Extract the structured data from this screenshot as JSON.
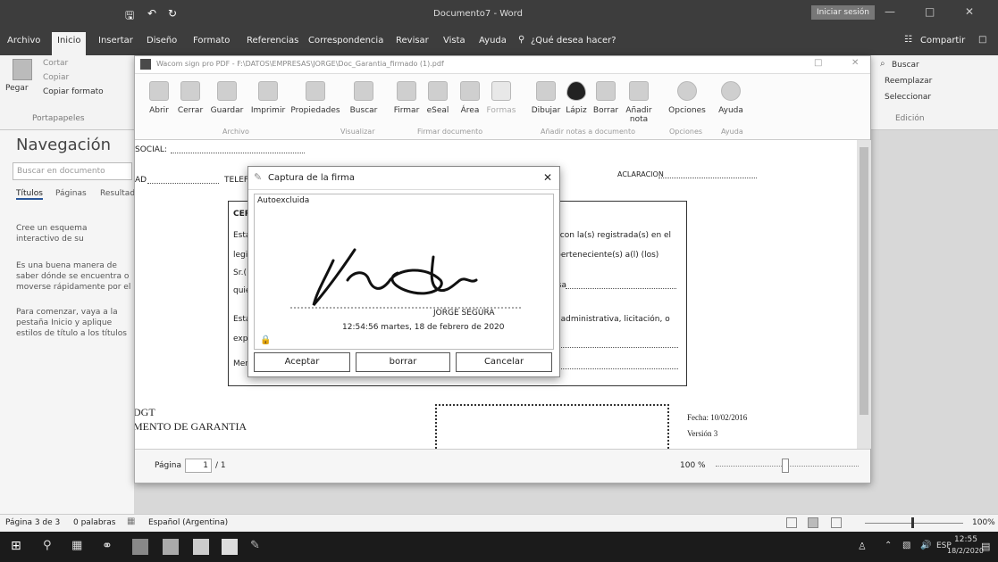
{
  "word": {
    "title": "Documento7 - Word",
    "user": "Iniciar sesión",
    "tabs": [
      "Archivo",
      "Inicio",
      "Insertar",
      "Diseño",
      "Formato",
      "Referencias",
      "Correspondencia",
      "Revisar",
      "Vista",
      "Ayuda"
    ],
    "tell_me": "¿Qué desea hacer?",
    "share": "Compartir",
    "clipboard": {
      "paste": "Pegar",
      "cut": "Cortar",
      "copy": "Copiar",
      "format_painter": "Copiar formato",
      "group": "Portapapeles"
    },
    "editing": {
      "find": "Buscar",
      "replace": "Reemplazar",
      "select": "Seleccionar",
      "group": "Edición"
    },
    "navigation": {
      "title": "Navegación",
      "search_placeholder": "Buscar en documento",
      "tabs": [
        "Títulos",
        "Páginas",
        "Resultados"
      ],
      "text1": "Cree un esquema interactivo de su documento.",
      "text2": "Es una buena manera de saber dónde se encuentra o moverse rápidamente por el contenido.",
      "text3": "Para comenzar, vaya a la pestaña Inicio y aplique estilos de título a los títulos del documento."
    },
    "status": {
      "page": "Página 3 de 3",
      "words": "0 palabras",
      "language": "Español (Argentina)",
      "zoom": "100%"
    }
  },
  "pdf": {
    "title": "Wacom sign pro PDF - F:\\DATOS\\EMPRESAS\\JORGE\\Doc_Garantia_firmado (1).pdf",
    "toolbar": [
      {
        "label": "Abrir",
        "icon": "open-icon"
      },
      {
        "label": "Cerrar",
        "icon": "close-doc-icon"
      },
      {
        "label": "Guardar",
        "icon": "save-icon"
      },
      {
        "label": "Imprimir",
        "icon": "print-icon"
      },
      {
        "label": "Propiedades",
        "icon": "properties-icon"
      },
      {
        "label": "Buscar",
        "icon": "search-icon"
      },
      {
        "label": "Firmar",
        "icon": "sign-icon"
      },
      {
        "label": "eSeal",
        "icon": "eseal-icon"
      },
      {
        "label": "Área",
        "icon": "area-icon"
      },
      {
        "label": "Formas",
        "icon": "forms-icon"
      },
      {
        "label": "Dibujar",
        "icon": "draw-icon"
      },
      {
        "label": "Lápiz",
        "icon": "pencil-icon"
      },
      {
        "label": "Borrar",
        "icon": "eraser-icon"
      },
      {
        "label": "Añadir nota",
        "icon": "note-icon"
      },
      {
        "label": "Opciones",
        "icon": "options-icon"
      },
      {
        "label": "Ayuda",
        "icon": "help-icon"
      }
    ],
    "groups": [
      "Archivo",
      "Visualizar",
      "Firmar documento",
      "Añadir notas a documento",
      "Opciones",
      "Ayuda"
    ],
    "doc": {
      "social": "SOCIAL:",
      "ad": "AD",
      "telef": "TELEF",
      "aclaracion": "ACLARACION",
      "cer": "CER",
      "esta": "Esta",
      "legit": "legit",
      "sr": "Sr.(",
      "quie": "quie",
      "esta2": "Esta",
      "expi": "expi",
      "mer": "Mer",
      "line1": "tud con la(s) registrada(s) en el",
      "line2": "za perteneciente(s) a(l) (los)",
      "line3": "presa",
      "line4": "eza administrativa, licitación, o",
      "dgt": "DGT",
      "garantia": "MENTO DE GARANTIA",
      "fecha": "Fecha: 10/02/2016",
      "version": "Versión 3"
    },
    "status": {
      "page_label": "Página",
      "page_value": "1",
      "page_total": "/ 1",
      "zoom": "100 %"
    }
  },
  "dialog": {
    "title": "Captura de la firma",
    "subtitle": "Autoexcluida",
    "signer": "JORGE SEGURA",
    "timestamp": "12:54:56 martes, 18 de febrero de 2020",
    "buttons": {
      "accept": "Aceptar",
      "clear": "borrar",
      "cancel": "Cancelar"
    }
  },
  "taskbar": {
    "lang": "ESP",
    "time": "12:55",
    "date": "18/2/2020"
  }
}
